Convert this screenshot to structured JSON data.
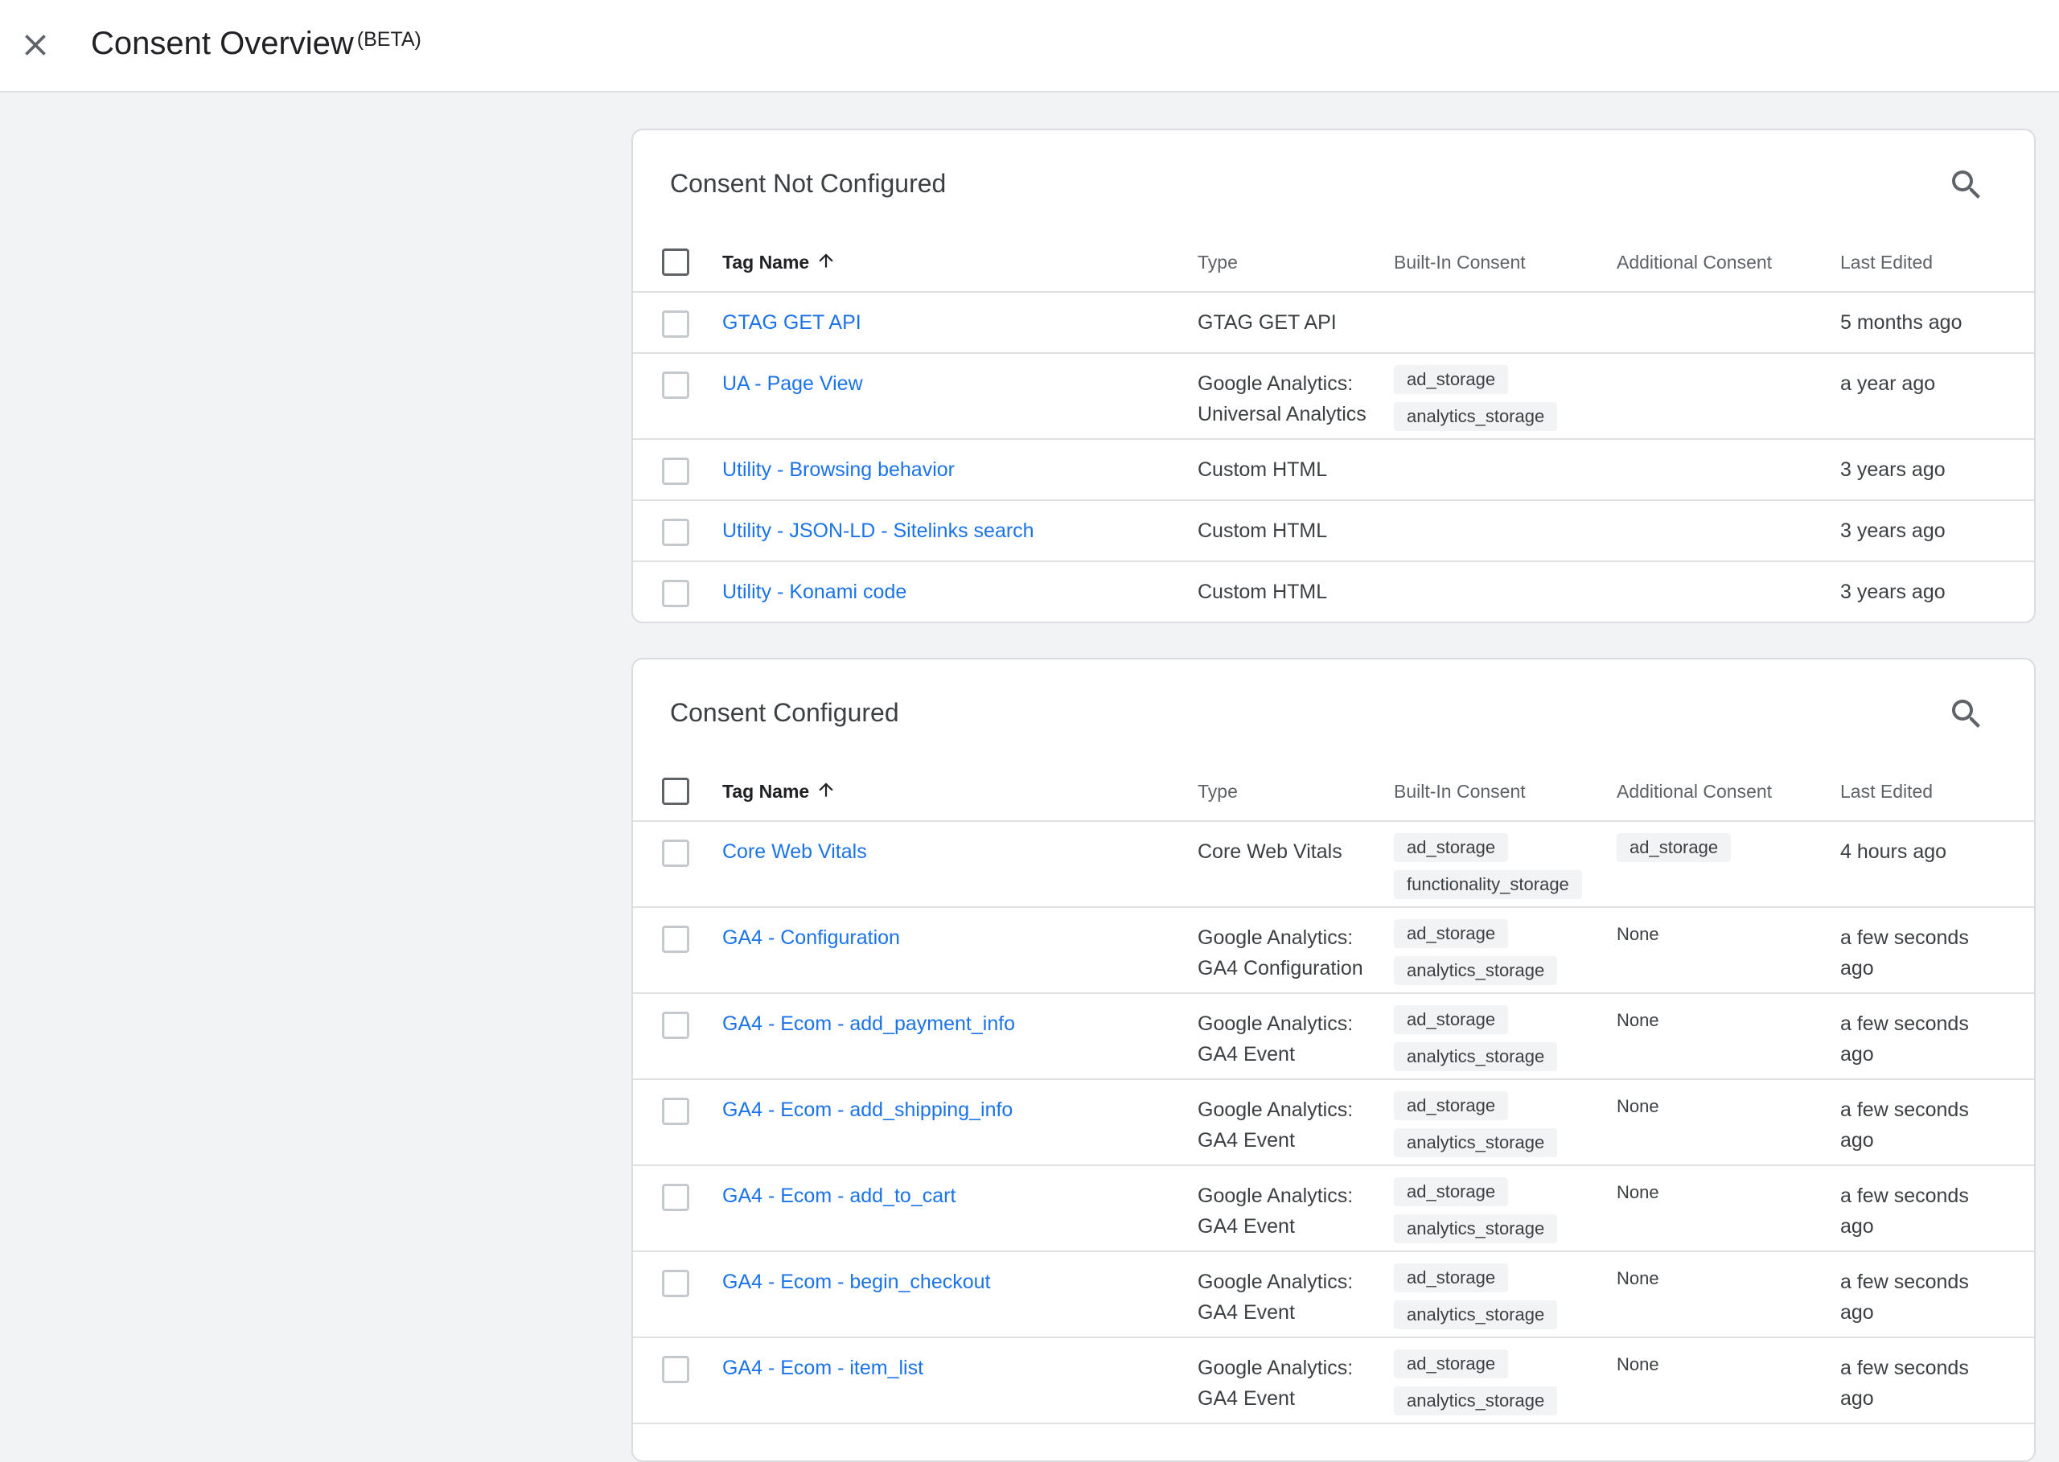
{
  "header": {
    "title": "Consent Overview",
    "beta": "(BETA)"
  },
  "columns": {
    "tag_name": "Tag Name",
    "type": "Type",
    "builtin": "Built-In Consent",
    "additional": "Additional Consent",
    "last_edited": "Last Edited"
  },
  "not_configured": {
    "title": "Consent Not Configured",
    "rows": [
      {
        "name": "GTAG GET API",
        "type": "GTAG GET API",
        "builtin": [],
        "additional": [],
        "last": "5 months ago"
      },
      {
        "name": "UA - Page View",
        "type": "Google Analytics: Universal Analytics",
        "builtin": [
          "ad_storage",
          "analytics_storage"
        ],
        "additional": [],
        "last": "a year ago"
      },
      {
        "name": "Utility - Browsing behavior",
        "type": "Custom HTML",
        "builtin": [],
        "additional": [],
        "last": "3 years ago"
      },
      {
        "name": "Utility - JSON-LD - Sitelinks search",
        "type": "Custom HTML",
        "builtin": [],
        "additional": [],
        "last": "3 years ago"
      },
      {
        "name": "Utility - Konami code",
        "type": "Custom HTML",
        "builtin": [],
        "additional": [],
        "last": "3 years ago"
      }
    ]
  },
  "configured": {
    "title": "Consent Configured",
    "rows": [
      {
        "name": "Core Web Vitals",
        "type": "Core Web Vitals",
        "builtin": [
          "ad_storage",
          "functionality_storage"
        ],
        "additional": [
          "ad_storage"
        ],
        "last": "4 hours ago"
      },
      {
        "name": "GA4 - Configuration",
        "type": "Google Analytics: GA4 Configuration",
        "builtin": [
          "ad_storage",
          "analytics_storage"
        ],
        "additional_text": "None",
        "last": "a few seconds ago"
      },
      {
        "name": "GA4 - Ecom - add_payment_info",
        "type": "Google Analytics: GA4 Event",
        "builtin": [
          "ad_storage",
          "analytics_storage"
        ],
        "additional_text": "None",
        "last": "a few seconds ago"
      },
      {
        "name": "GA4 - Ecom - add_shipping_info",
        "type": "Google Analytics: GA4 Event",
        "builtin": [
          "ad_storage",
          "analytics_storage"
        ],
        "additional_text": "None",
        "last": "a few seconds ago"
      },
      {
        "name": "GA4 - Ecom - add_to_cart",
        "type": "Google Analytics: GA4 Event",
        "builtin": [
          "ad_storage",
          "analytics_storage"
        ],
        "additional_text": "None",
        "last": "a few seconds ago"
      },
      {
        "name": "GA4 - Ecom - begin_checkout",
        "type": "Google Analytics: GA4 Event",
        "builtin": [
          "ad_storage",
          "analytics_storage"
        ],
        "additional_text": "None",
        "last": "a few seconds ago"
      },
      {
        "name": "GA4 - Ecom - item_list",
        "type": "Google Analytics: GA4 Event",
        "builtin": [
          "ad_storage",
          "analytics_storage"
        ],
        "additional_text": "None",
        "last": "a few seconds ago"
      }
    ]
  }
}
